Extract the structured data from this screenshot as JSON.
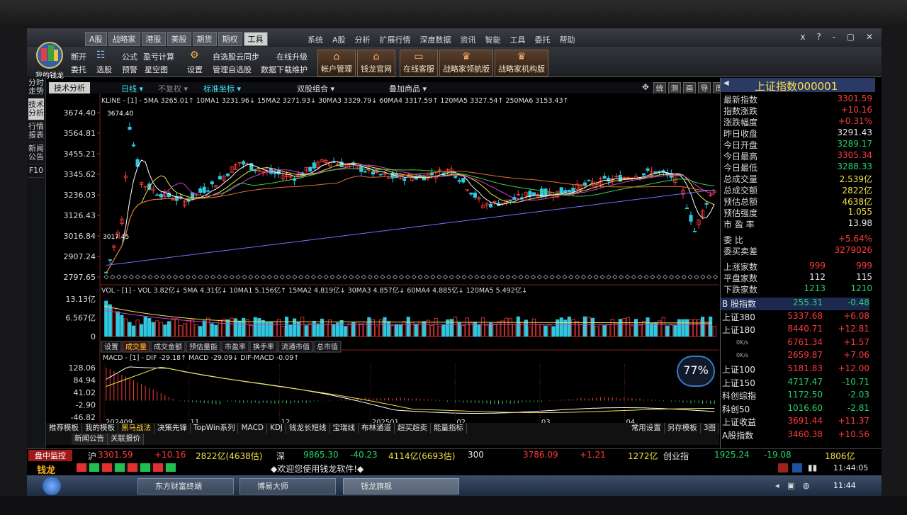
{
  "colors": {
    "up": "#ff3a3a",
    "down": "#27d36a",
    "ma1": "#ffffff",
    "ma2": "#f0e04a",
    "ma3": "#d040d0",
    "ma4": "#40d040",
    "ma5": "#e07030",
    "ma6": "#7070ff",
    "panel": "#000000"
  },
  "menubar": {
    "tabs": [
      "A股",
      "战略家",
      "港股",
      "美股",
      "期货",
      "期权",
      "工具"
    ],
    "menus": [
      "系统",
      "A股",
      "分析",
      "扩展行情",
      "深度数据",
      "资讯",
      "智能",
      "工具",
      "委托",
      "帮助"
    ],
    "window_buttons": "x ? - ▢ ✕"
  },
  "toolbar": {
    "logo_label": "我的钱龙",
    "b1": "断开",
    "b2": "委托",
    "b3": "选股",
    "b4": "公式",
    "b5": "预警",
    "b6": "盈亏计算",
    "b7": "星空图",
    "b8": "设置",
    "b9": "自选股云同步",
    "b10": "管理自选股",
    "b11": "在线升级",
    "b12": "数据下载维护",
    "big1": "帐户管理",
    "big2": "钱龙官网",
    "big3": "在线客服",
    "big4": "战略家领航版",
    "big5": "战略家机构版"
  },
  "leftnav": [
    "分时走势",
    "技术分析",
    "行情报表",
    "新闻公告",
    "F10"
  ],
  "chartbar": {
    "title": "技术分析",
    "period": "日线 ▾",
    "fq": "不复权 ▾",
    "coord": "标准坐标 ▾",
    "combo": "双股组合 ▾",
    "overlay": "叠加商品 ▾",
    "tools": [
      "统",
      "测",
      "画",
      "导",
      "周"
    ]
  },
  "kline": {
    "label": "KLINE - [1] - 5MA 3265.01↑ 10MA1 3231.96↓ 15MA2 3271.93↓ 30MA3 3329.79↓ 60MA4 3317.59↑ 120MA5 3327.54↑ 250MA6 3153.43↑",
    "yticks": [
      "3674.40",
      "3564.81",
      "3455.21",
      "3345.62",
      "3236.03",
      "3126.43",
      "3016.84",
      "2907.24",
      "2797.65"
    ],
    "high_label": "3674.40",
    "low_label": "3017.45"
  },
  "vol": {
    "label": "VOL - [1] - VOL 3.82亿↓ 5MA 4.31亿↓ 10MA1 5.156亿↑ 15MA2 4.819亿↓ 30MA3 4.857亿↓ 60MA4 4.885亿↓ 120MA5 5.492亿↓",
    "yticks": [
      "13.13亿",
      "6.567亿",
      "0"
    ],
    "tabs": [
      "设置",
      "成交量",
      "成交金额",
      "预估量能",
      "市盈率",
      "换手率",
      "流通市值",
      "总市值"
    ]
  },
  "macd": {
    "label": "MACD - [1] - DIF -29.18↑ MACD -29.09↓ DIF-MACD -0.09↑",
    "yticks": [
      "128.06",
      "84.94",
      "41.02",
      "-2.90",
      "-46.82"
    ],
    "xticks": [
      "202409",
      "11",
      "12",
      "202501",
      "02",
      "03",
      "04"
    ],
    "gauge": "77%"
  },
  "bottom_tabs": [
    "推荐模板",
    "我的模板",
    "黑马战法",
    "决策先锋",
    "TopWin系列",
    "MACD",
    "KDJ",
    "钱龙长短线",
    "宝瑞线",
    "布林通道",
    "超买超卖",
    "能量指标"
  ],
  "bottom_right": [
    "常用设置",
    "另存模板",
    "3图"
  ],
  "news_tabs": [
    "新闻公告",
    "关联报价"
  ],
  "quote": {
    "title": "上证指数000001",
    "rows": [
      {
        "l": "最新指数",
        "v": "3301.59",
        "c": "red"
      },
      {
        "l": "指数涨跌",
        "v": "+10.16",
        "c": "red"
      },
      {
        "l": "涨跌幅度",
        "v": "+0.31%",
        "c": "red"
      },
      {
        "l": "昨日收盘",
        "v": "3291.43",
        "c": "wht"
      },
      {
        "l": "今日开盘",
        "v": "3289.17",
        "c": "grn"
      },
      {
        "l": "今日最高",
        "v": "3305.34",
        "c": "red"
      },
      {
        "l": "今日最低",
        "v": "3288.33",
        "c": "grn"
      },
      {
        "l": "总成交量",
        "v": "2.539亿",
        "c": "yel"
      },
      {
        "l": "总成交额",
        "v": "2822亿",
        "c": "yel"
      },
      {
        "l": "预估总额",
        "v": "4638亿",
        "c": "yel"
      },
      {
        "l": "预估强度",
        "v": "1.055",
        "c": "yel"
      },
      {
        "l": "市 盈 率",
        "v": "13.98",
        "c": "wht"
      }
    ],
    "weibi": {
      "l": "委 比",
      "v": "+5.64%"
    },
    "weicha": {
      "l": "委买卖差",
      "v": "3279026"
    },
    "breadth": [
      {
        "l": "上涨家数",
        "a": "999",
        "b": "999",
        "c": "red"
      },
      {
        "l": "平盘家数",
        "a": "112",
        "b": "115",
        "c": "wht"
      },
      {
        "l": "下跌家数",
        "a": "1213",
        "b": "1210",
        "c": "grn"
      }
    ],
    "indices": [
      {
        "n": "B 股指数",
        "p": "255.31",
        "c": "-0.48",
        "col": "grn"
      },
      {
        "n": "上证380",
        "p": "5337.68",
        "c": "+6.08",
        "col": "red"
      },
      {
        "n": "上证180",
        "p": "8440.71",
        "c": "+12.81",
        "col": "red"
      },
      {
        "n": "",
        "p": "6761.34",
        "c": "+1.57",
        "col": "red"
      },
      {
        "n": "",
        "p": "2659.87",
        "c": "+7.06",
        "col": "red"
      },
      {
        "n": "上证100",
        "p": "5181.83",
        "c": "+12.00",
        "col": "red"
      },
      {
        "n": "上证150",
        "p": "4717.47",
        "c": "-10.71",
        "col": "grn"
      },
      {
        "n": "科创综指",
        "p": "1172.50",
        "c": "-2.03",
        "col": "grn"
      },
      {
        "n": "科创50",
        "p": "1016.60",
        "c": "-2.81",
        "col": "grn"
      },
      {
        "n": "上证收益",
        "p": "3691.44",
        "c": "+11.37",
        "col": "red"
      },
      {
        "n": "A股指数",
        "p": "3460.38",
        "c": "+10.56",
        "col": "red"
      }
    ],
    "net": [
      "0K/s",
      "0K/s"
    ],
    "bottom_icons": [
      "指",
      "合",
      "资",
      "关",
      "值",
      "钟"
    ]
  },
  "status": {
    "label": "盘中监控",
    "sh": "沪",
    "sh_p": "3301.59",
    "sh_c": "+10.16",
    "sh_amt": "2822亿(4638估)",
    "sz": "深",
    "sz_p": "9865.30",
    "sz_c": "-40.23",
    "sz_amt": "4114亿(6693估)",
    "hs": "300",
    "hs_p": "3786.09",
    "hs_c": "+1.21",
    "hs_amt": "1272亿",
    "cy": "创业指",
    "cy_p": "1925.24",
    "cy_c": "-19.08",
    "cy_amt": "1806亿"
  },
  "status2": {
    "brand": "钱龙",
    "welcome": "◆欢迎您使用钱龙软件!◆",
    "time": "11:44:05"
  },
  "taskbar": {
    "items": [
      "东方财富终端",
      "博易大师",
      "钱龙旗舰"
    ],
    "time": "11:44"
  }
}
